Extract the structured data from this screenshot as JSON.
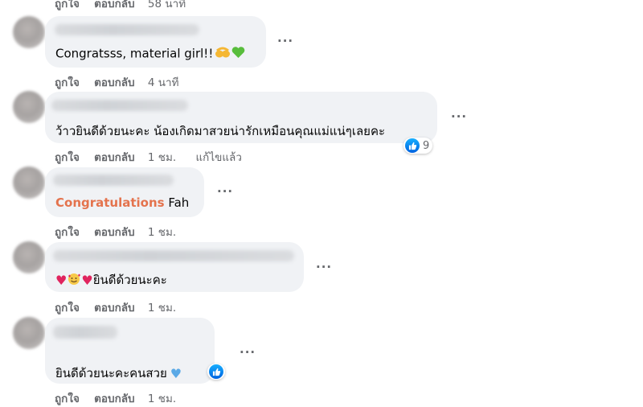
{
  "actions": {
    "like": "ถูกใจ",
    "reply": "ตอบกลับ"
  },
  "comments": [
    {
      "time": "58 นาที"
    },
    {
      "text": "Congratsss, material girl!!",
      "time": "4 นาที",
      "emoji": [
        "hugging-hands-emoji",
        "green-heart-emoji"
      ]
    },
    {
      "text": "ว้าวยินดีด้วยนะคะ น้องเกิดมาสวยน่ารักเหมือนคุณแม่แน่ๆเลยคะ",
      "time": "1 ชม.",
      "edited": "แก้ไขแล้ว",
      "reaction_count": "9"
    },
    {
      "highlight": "Congratulations",
      "text": " Fah",
      "time": "1 ชม.",
      "highlight_color": "#e4734d"
    },
    {
      "text": "ยินดีด้วยนะคะ",
      "time": "1 ชม.",
      "emoji": [
        "red-heart-emoji",
        "smiling-face-with-hearts-emoji",
        "red-heart-emoji"
      ]
    },
    {
      "text": "ยินดีด้วยนะคะคนสวย",
      "time": "1 ชม.",
      "emoji": [
        "blue-heart-emoji"
      ]
    }
  ],
  "more_label": "···",
  "colors": {
    "bubble": "#f0f2f5",
    "meta": "#65676b",
    "like_blue": "#0866ff"
  }
}
